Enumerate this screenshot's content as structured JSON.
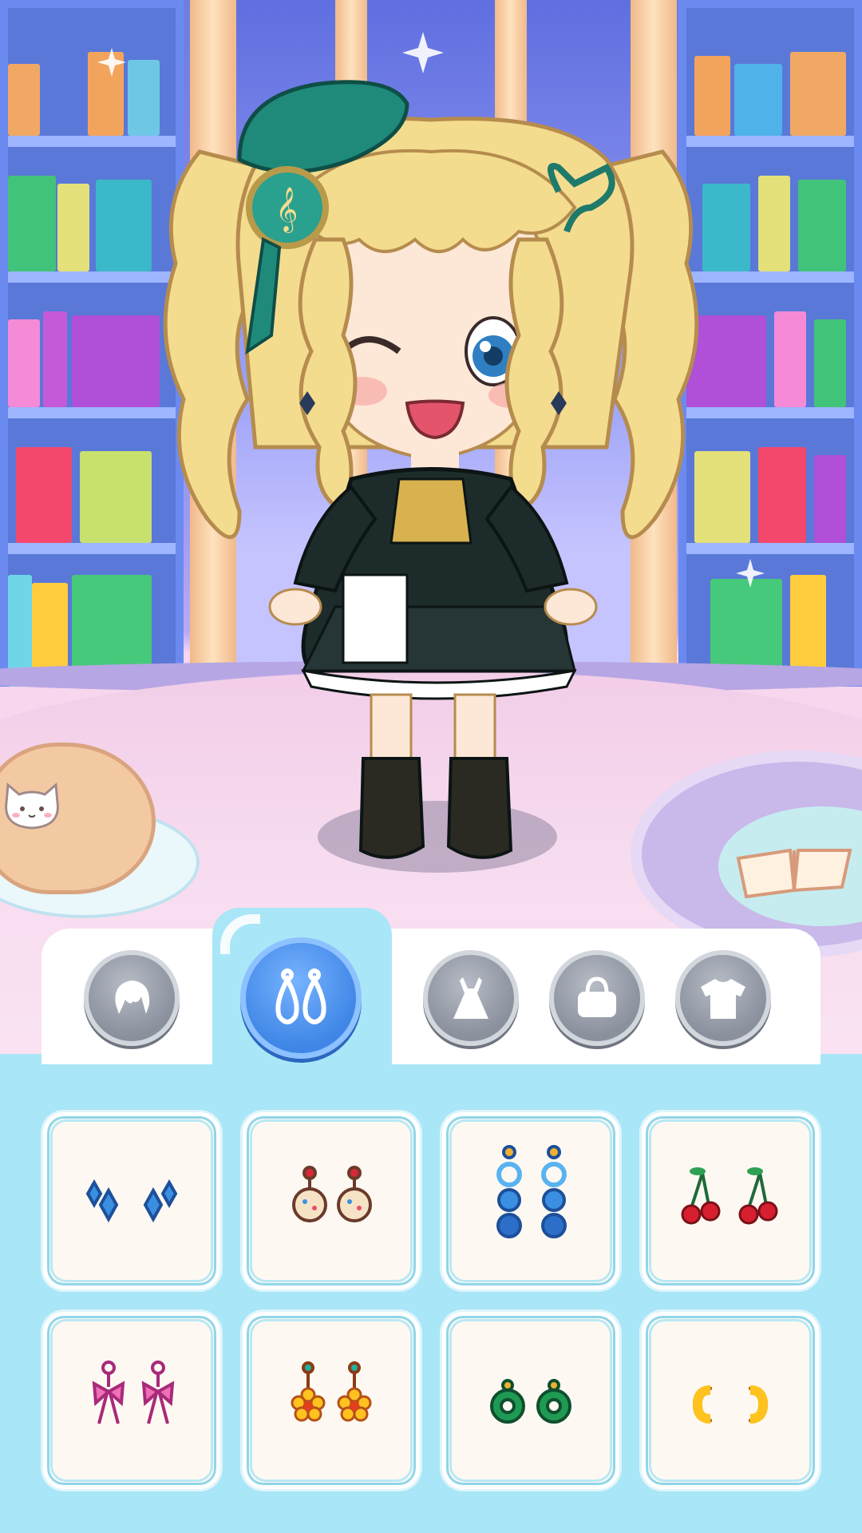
{
  "game": {
    "screen": "dress-up",
    "colors": {
      "panel_background": "#a9e6f7",
      "tab_active": "#3f86e6",
      "tab_inactive": "#8a909c",
      "item_card": "#fdf9f2"
    }
  },
  "category_tabs": [
    {
      "id": "hair",
      "icon": "hair-icon",
      "active": false
    },
    {
      "id": "earrings",
      "icon": "earrings-icon",
      "active": true
    },
    {
      "id": "dress",
      "icon": "dress-icon",
      "active": false
    },
    {
      "id": "bag",
      "icon": "handbag-icon",
      "active": false
    },
    {
      "id": "top",
      "icon": "tshirt-icon",
      "active": false
    }
  ],
  "earring_items": [
    {
      "icon": "blue-diamond-earrings-icon"
    },
    {
      "icon": "cookie-earrings-icon"
    },
    {
      "icon": "blue-bead-drop-earrings-icon"
    },
    {
      "icon": "cherry-earrings-icon"
    },
    {
      "icon": "pink-bow-earrings-icon"
    },
    {
      "icon": "yellow-flower-earrings-icon"
    },
    {
      "icon": "green-jade-earrings-icon"
    },
    {
      "icon": "gold-hoop-earrings-icon"
    }
  ]
}
